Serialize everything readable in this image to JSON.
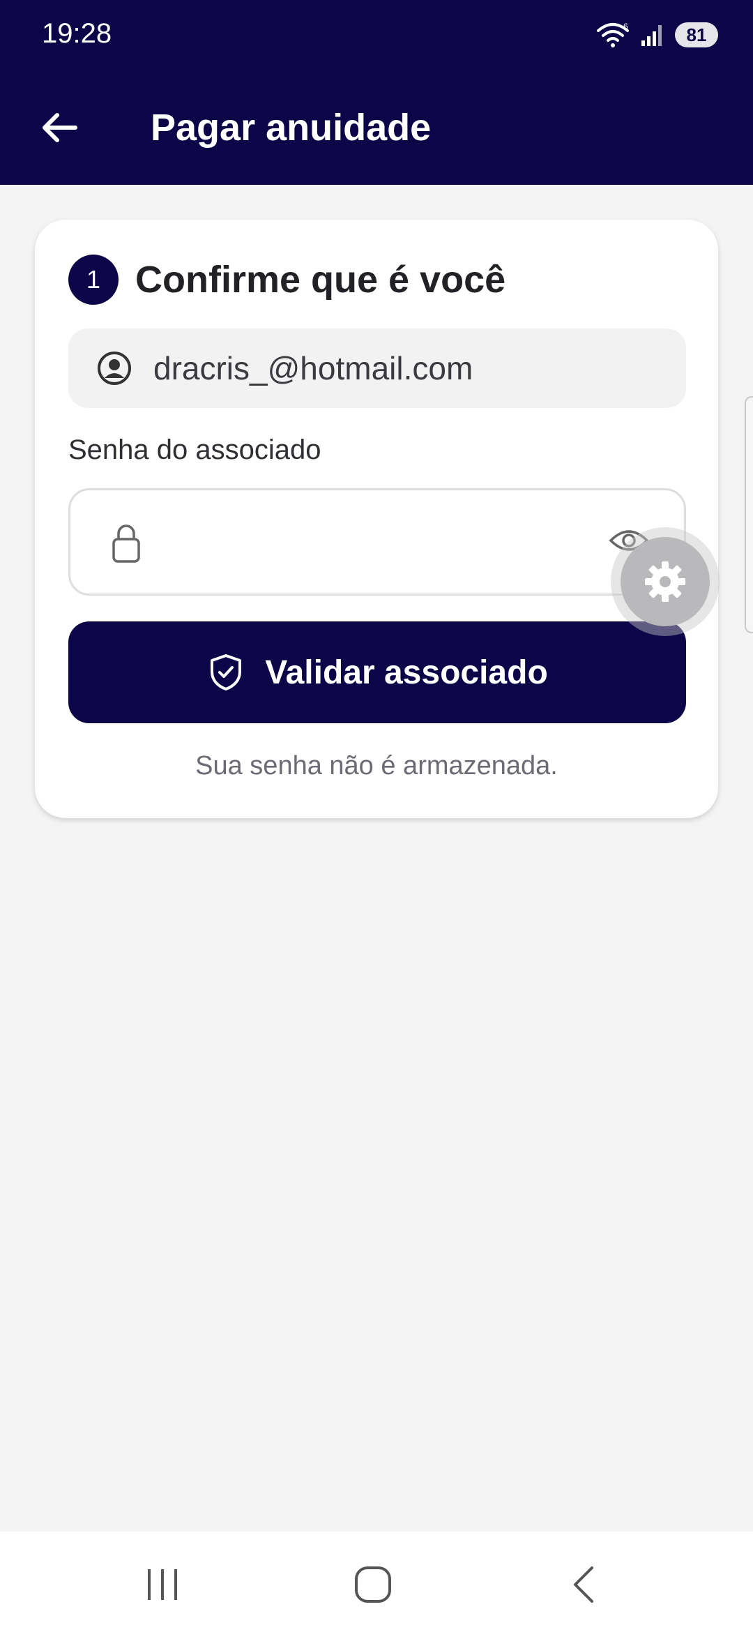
{
  "status_bar": {
    "time": "19:28",
    "battery": "81",
    "icons": [
      "wifi-icon",
      "signal-icon",
      "battery-icon"
    ]
  },
  "header": {
    "title": "Pagar anuidade",
    "back_icon": "arrow-left-icon"
  },
  "card": {
    "step_number": "1",
    "step_title": "Confirme que é você",
    "email": "dracris_@hotmail.com",
    "password_label": "Senha do associado",
    "password_value": "",
    "validate_label": "Validar associado",
    "note": "Sua senha não é armazenada."
  },
  "colors": {
    "primary": "#0c0548",
    "background": "#f4f4f5",
    "card": "#ffffff"
  },
  "nav": {
    "items": [
      "recent-apps-icon",
      "home-icon",
      "back-icon"
    ]
  }
}
